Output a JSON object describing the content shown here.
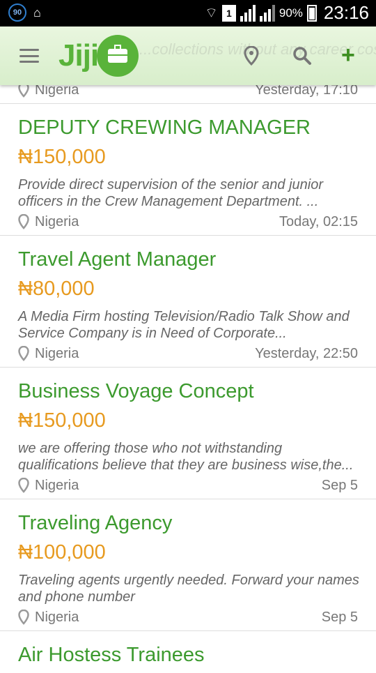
{
  "status_bar": {
    "badge": "90",
    "sim": "1",
    "battery": "90%",
    "time": "23:16"
  },
  "app_bar": {
    "logo_text": "Jiji",
    "ghost_text": "...collections without any career cost"
  },
  "partial_item": {
    "location": "Nigeria",
    "date": "Yesterday, 17:10"
  },
  "items": [
    {
      "title": "DEPUTY CREWING MANAGER",
      "price": "₦150,000",
      "description": "Provide direct supervision of the senior and junior officers in the Crew Management Department. ...",
      "location": "Nigeria",
      "date": "Today, 02:15"
    },
    {
      "title": "Travel Agent Manager",
      "price": "₦80,000",
      "description": "A Media Firm hosting Television/Radio Talk Show and Service Company is in Need of Corporate...",
      "location": "Nigeria",
      "date": "Yesterday, 22:50"
    },
    {
      "title": "Business Voyage Concept",
      "price": "₦150,000",
      "description": "we are offering those who not withstanding qualifications believe that they are business wise,the...",
      "location": "Nigeria",
      "date": "Sep 5"
    },
    {
      "title": "Traveling Agency",
      "price": "₦100,000",
      "description": "Traveling agents urgently needed. Forward your names and phone number",
      "location": "Nigeria",
      "date": "Sep 5"
    }
  ],
  "last_item": {
    "title": "Air Hostess Trainees"
  },
  "colors": {
    "brand_green": "#59b33a",
    "title_green": "#3c9a2e",
    "price_orange": "#e79a1f"
  }
}
